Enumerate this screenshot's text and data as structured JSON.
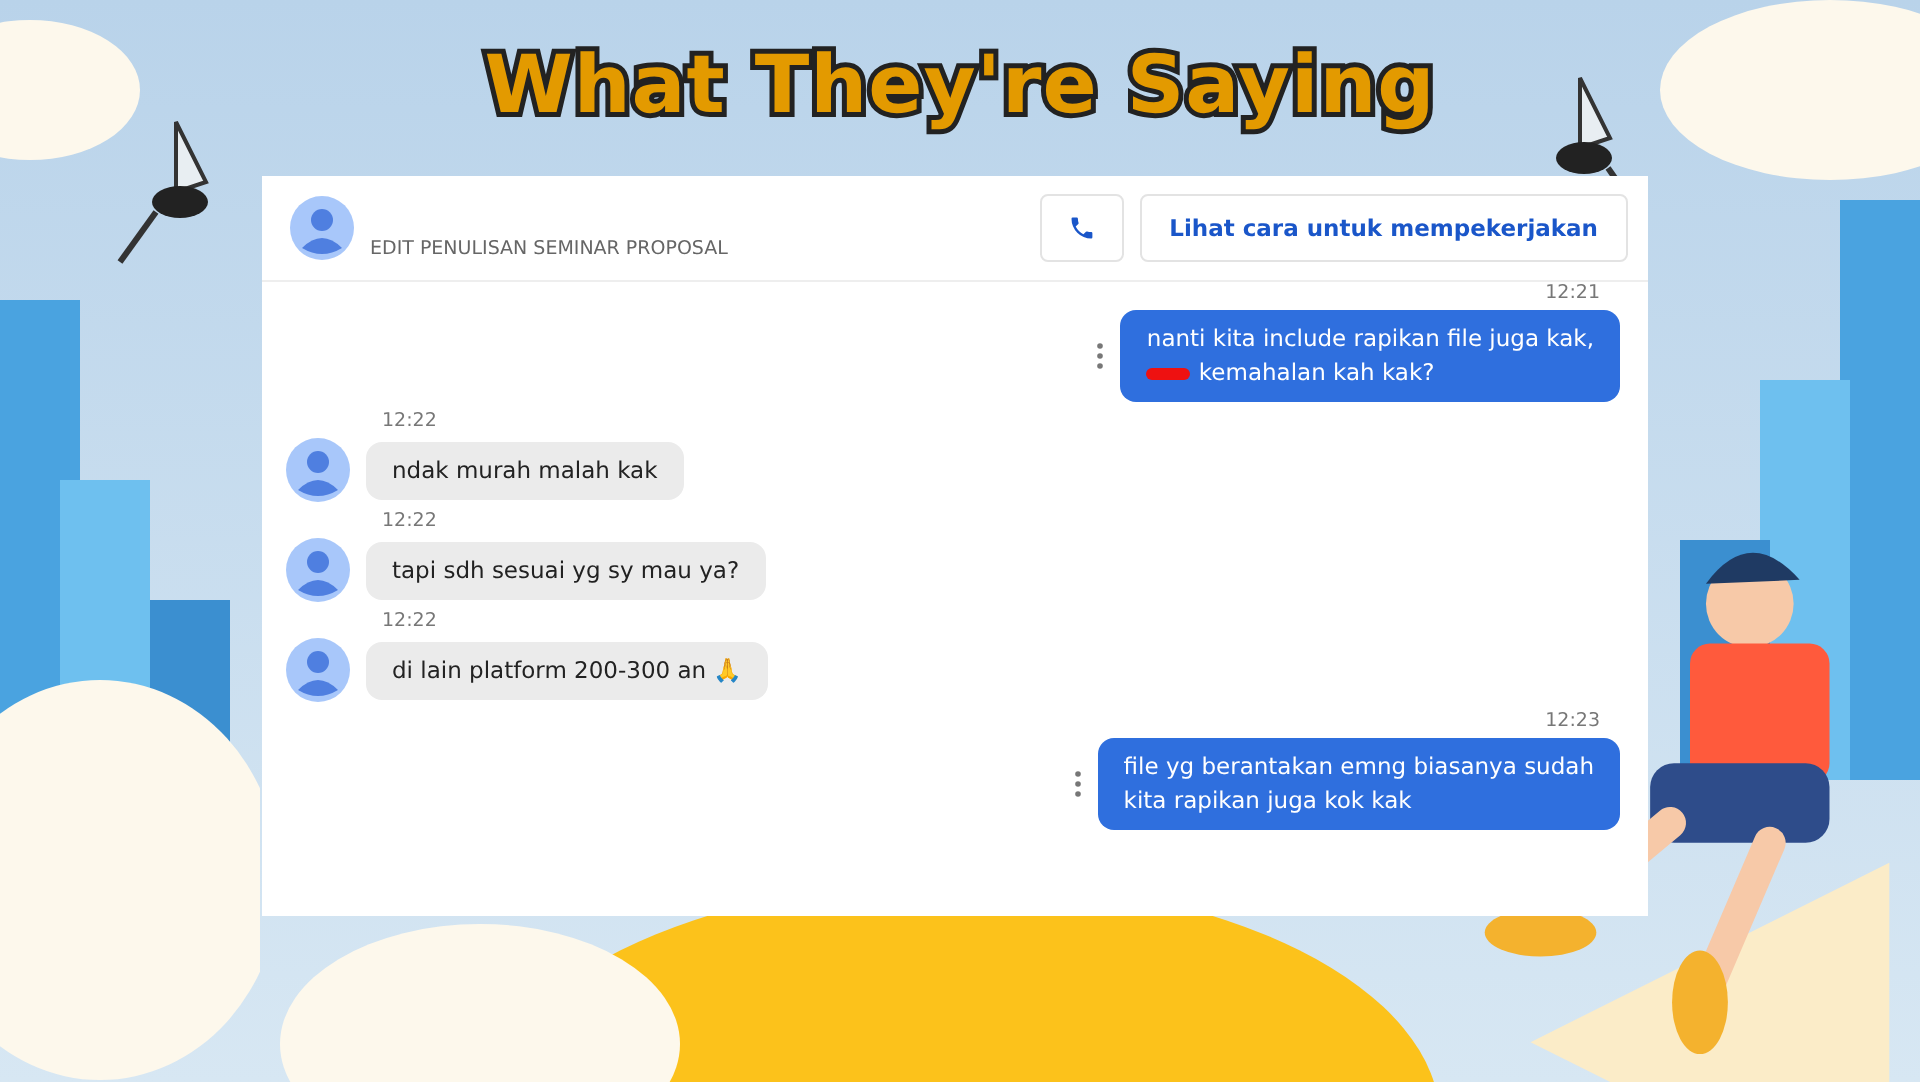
{
  "slide_title": "What They're Saying",
  "chat": {
    "header": {
      "subtitle": "EDIT PENULISAN SEMINAR PROPOSAL",
      "hire_button": "Lihat cara untuk mempekerjakan"
    },
    "messages": [
      {
        "kind": "outgoing",
        "time": "12:21",
        "lines": [
          "nanti kita include rapikan file juga kak,",
          "kemahalan kah kak?"
        ],
        "redacted": true
      },
      {
        "kind": "incoming",
        "time": "12:22",
        "lines": [
          "ndak murah malah kak"
        ],
        "redacted": false
      },
      {
        "kind": "incoming",
        "time": "12:22",
        "lines": [
          "tapi sdh sesuai yg sy mau ya?"
        ],
        "redacted": false
      },
      {
        "kind": "incoming",
        "time": "12:22",
        "lines": [
          "di lain platform 200-300 an 🙏"
        ],
        "redacted": false
      },
      {
        "kind": "outgoing",
        "time": "12:23",
        "lines": [
          "file yg berantakan emng biasanya sudah",
          "kita rapikan juga kok kak"
        ],
        "redacted": false
      }
    ]
  }
}
